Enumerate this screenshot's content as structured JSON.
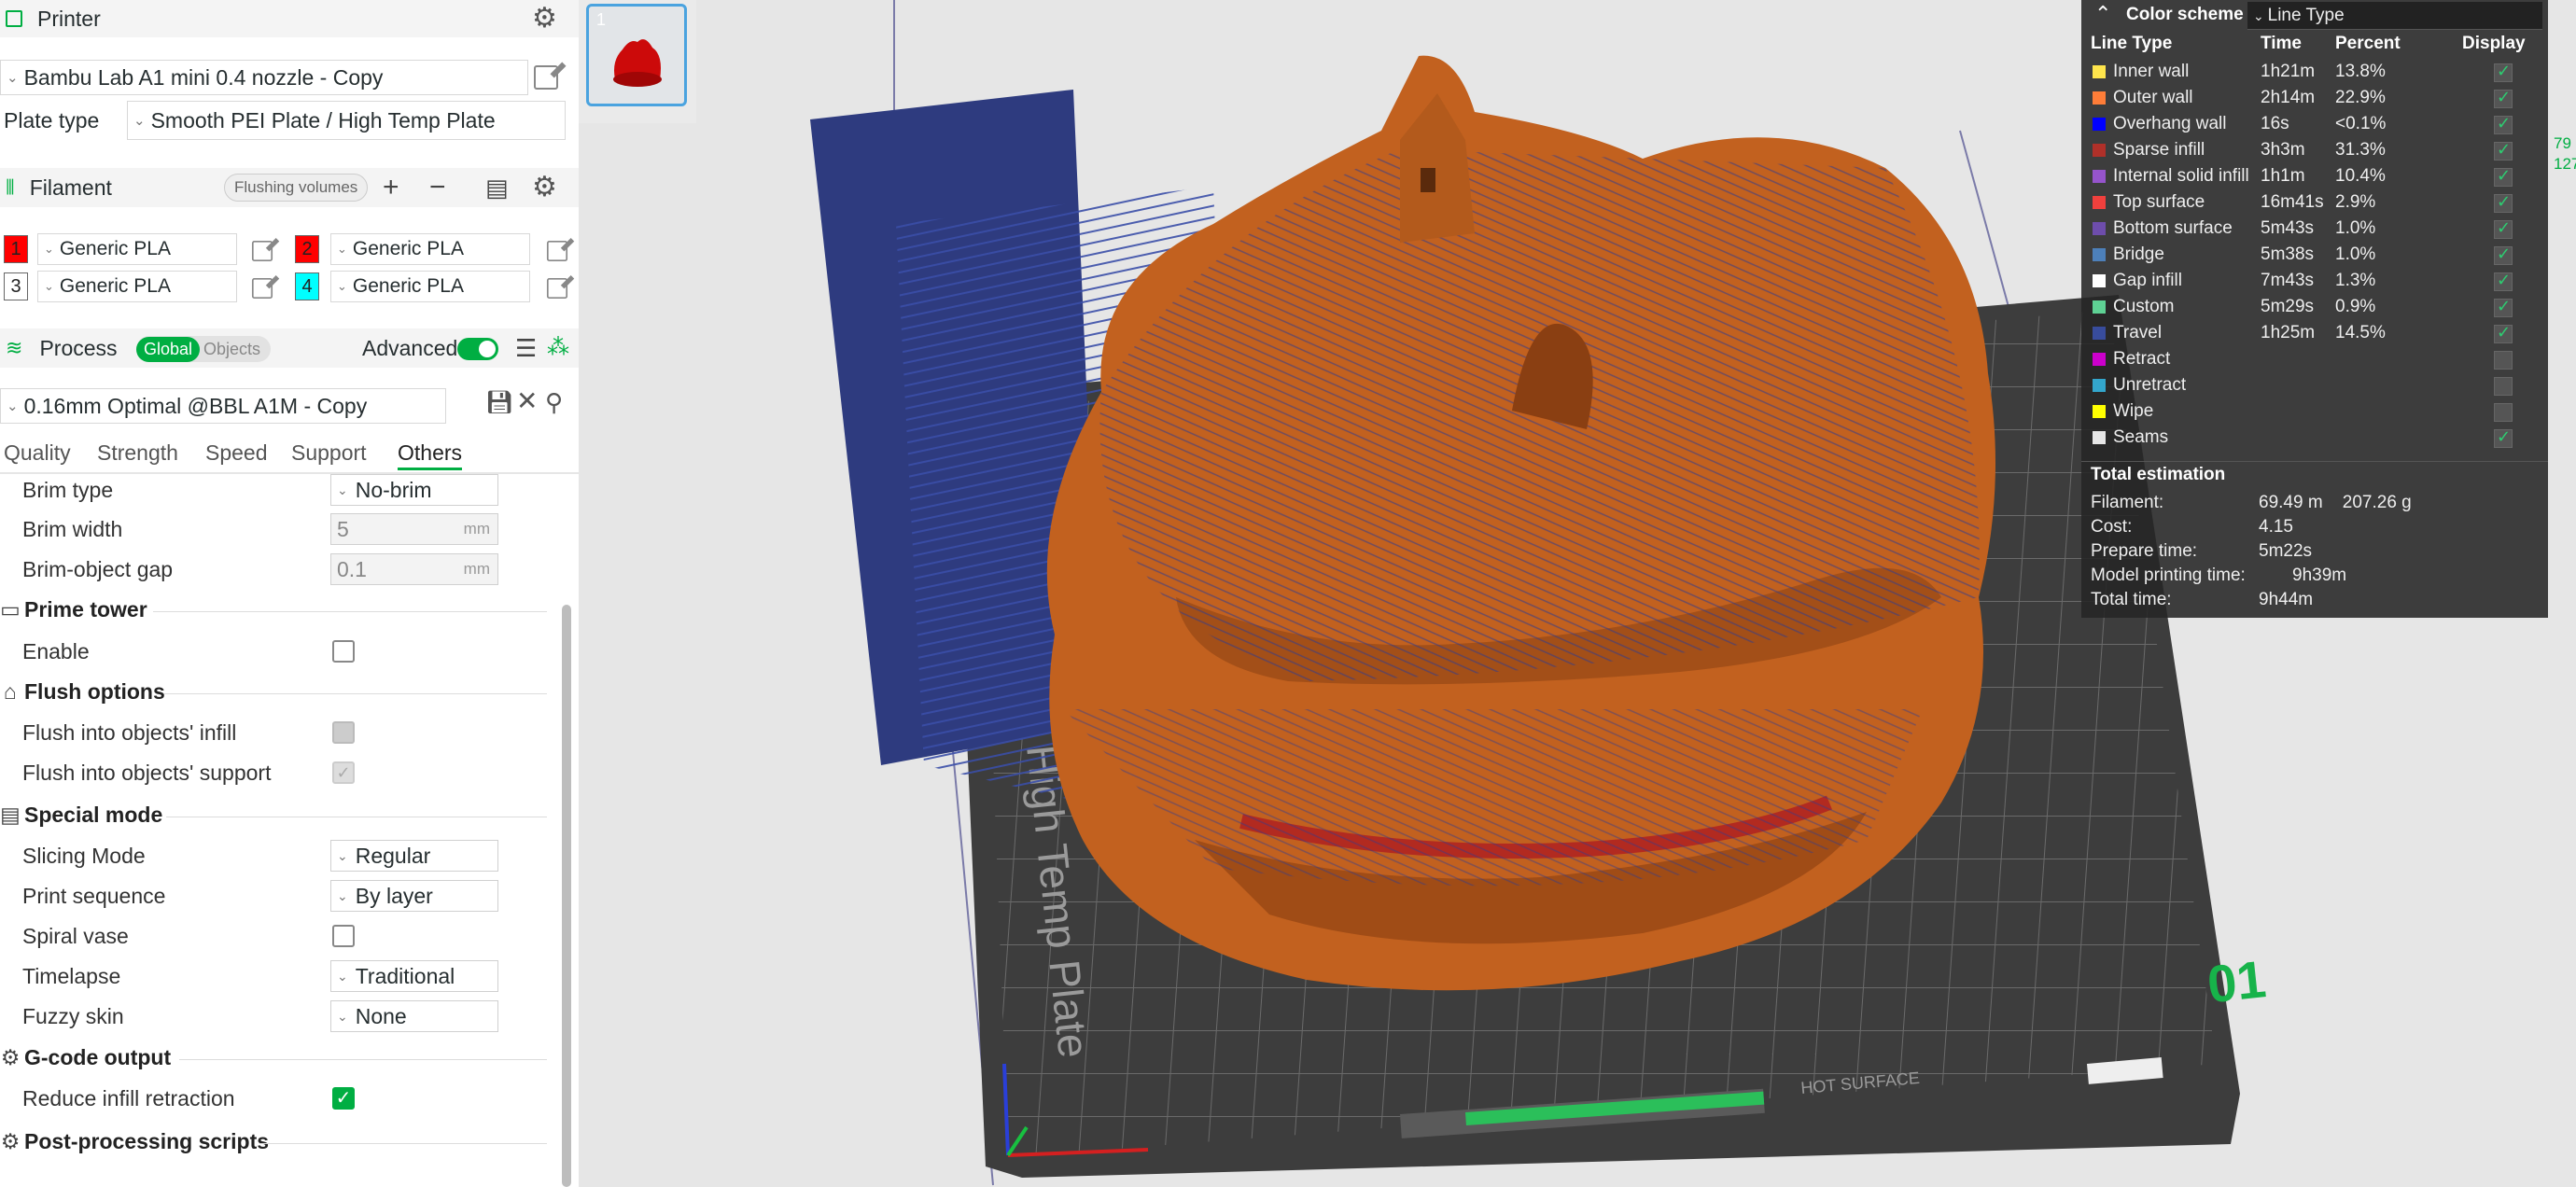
{
  "printer": {
    "title": "Printer",
    "name": "Bambu Lab A1 mini 0.4 nozzle - Copy",
    "plate_type_label": "Plate type",
    "plate_type": "Smooth PEI Plate / High Temp Plate"
  },
  "filament": {
    "title": "Filament",
    "flushing_label": "Flushing volumes",
    "slots": [
      {
        "num": "1",
        "name": "Generic PLA",
        "color": "#ff0000"
      },
      {
        "num": "2",
        "name": "Generic PLA",
        "color": "#ff0000"
      },
      {
        "num": "3",
        "name": "Generic PLA",
        "color": "#ffffff"
      },
      {
        "num": "4",
        "name": "Generic PLA",
        "color": "#00ffff"
      }
    ]
  },
  "process": {
    "title": "Process",
    "global_label": "Global",
    "objects_label": "Objects",
    "advanced_label": "Advanced",
    "preset": "0.16mm Optimal @BBL A1M - Copy",
    "tabs": [
      "Quality",
      "Strength",
      "Speed",
      "Support",
      "Others"
    ],
    "active_tab": "Others"
  },
  "settings": {
    "brim_type": {
      "label": "Brim type",
      "value": "No-brim"
    },
    "brim_width": {
      "label": "Brim width",
      "value": "5",
      "unit": "mm"
    },
    "brim_gap": {
      "label": "Brim-object gap",
      "value": "0.1",
      "unit": "mm"
    },
    "prime_tower": {
      "title": "Prime tower",
      "enable_label": "Enable"
    },
    "flush": {
      "title": "Flush options",
      "infill_label": "Flush into objects' infill",
      "support_label": "Flush into objects' support"
    },
    "special": {
      "title": "Special mode",
      "slicing_label": "Slicing Mode",
      "slicing_value": "Regular",
      "sequence_label": "Print sequence",
      "sequence_value": "By layer",
      "spiral_label": "Spiral vase",
      "timelapse_label": "Timelapse",
      "timelapse_value": "Traditional",
      "fuzzy_label": "Fuzzy skin",
      "fuzzy_value": "None"
    },
    "gcode": {
      "title": "G-code output",
      "reduce_label": "Reduce infill retraction"
    },
    "post": {
      "title": "Post-processing scripts"
    }
  },
  "plate": {
    "thumb_num": "1",
    "bed_label": "High Temp Plate",
    "plate_num": "01",
    "hot_surface": "HOT SURFACE"
  },
  "legend": {
    "scheme_label": "Color scheme",
    "scheme_value": "Line Type",
    "headers": {
      "type": "Line Type",
      "time": "Time",
      "percent": "Percent",
      "display": "Display"
    },
    "rows": [
      {
        "name": "Inner wall",
        "time": "1h21m",
        "percent": "13.8%",
        "color": "#ffe54c",
        "on": true
      },
      {
        "name": "Outer wall",
        "time": "2h14m",
        "percent": "22.9%",
        "color": "#ff7d38",
        "on": true
      },
      {
        "name": "Overhang wall",
        "time": "16s",
        "percent": "<0.1%",
        "color": "#0000ff",
        "on": true
      },
      {
        "name": "Sparse infill",
        "time": "3h3m",
        "percent": "31.3%",
        "color": "#b03029",
        "on": true
      },
      {
        "name": "Internal solid infill",
        "time": "1h1m",
        "percent": "10.4%",
        "color": "#9654cc",
        "on": true
      },
      {
        "name": "Top surface",
        "time": "16m41s",
        "percent": "2.9%",
        "color": "#f0403d",
        "on": true
      },
      {
        "name": "Bottom surface",
        "time": "5m43s",
        "percent": "1.0%",
        "color": "#6e4dac",
        "on": true
      },
      {
        "name": "Bridge",
        "time": "5m38s",
        "percent": "1.0%",
        "color": "#4d80ba",
        "on": true
      },
      {
        "name": "Gap infill",
        "time": "7m43s",
        "percent": "1.3%",
        "color": "#ffffff",
        "on": true
      },
      {
        "name": "Custom",
        "time": "5m29s",
        "percent": "0.9%",
        "color": "#5ed194",
        "on": true
      },
      {
        "name": "Travel",
        "time": "1h25m",
        "percent": "14.5%",
        "color": "#384c9c",
        "on": true
      },
      {
        "name": "Retract",
        "time": "",
        "percent": "",
        "color": "#cc00cc",
        "on": false
      },
      {
        "name": "Unretract",
        "time": "",
        "percent": "",
        "color": "#33a6cc",
        "on": false
      },
      {
        "name": "Wipe",
        "time": "",
        "percent": "",
        "color": "#ffff00",
        "on": false
      },
      {
        "name": "Seams",
        "time": "",
        "percent": "",
        "color": "#e6e6e6",
        "on": true
      }
    ],
    "total_title": "Total estimation",
    "totals": [
      {
        "label": "Filament:",
        "value": "69.49 m    207.26 g"
      },
      {
        "label": "Cost:",
        "value": "4.15"
      },
      {
        "label": "Prepare time:",
        "value": "5m22s"
      },
      {
        "label": "Model printing time:",
        "value": "9h39m"
      },
      {
        "label": "Total time:",
        "value": "9h44m"
      }
    ]
  },
  "right_nums": [
    "79",
    "127"
  ]
}
